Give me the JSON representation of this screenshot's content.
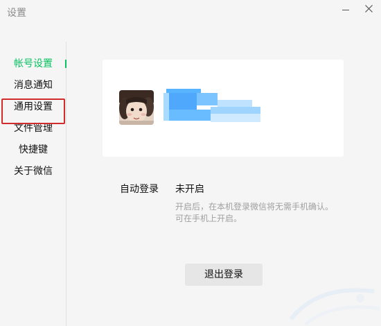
{
  "window": {
    "title": "设置",
    "minimize_icon": "minimize-icon",
    "close_icon": "close-icon"
  },
  "sidebar": {
    "items": [
      {
        "label": "帐号设置",
        "active": true
      },
      {
        "label": "消息通知",
        "active": false
      },
      {
        "label": "通用设置",
        "active": false,
        "highlighted": true
      },
      {
        "label": "文件管理",
        "active": false
      },
      {
        "label": "快捷键",
        "active": false
      },
      {
        "label": "关于微信",
        "active": false
      }
    ]
  },
  "account": {
    "avatar_icon": "avatar-photo",
    "name_obscured": true
  },
  "auto_login": {
    "label": "自动登录",
    "value": "未开启",
    "description_line1": "开启后，在本机登录微信将无需手机确认。",
    "description_line2": "可在手机上开启。"
  },
  "logout_button": {
    "label": "退出登录"
  },
  "colors": {
    "accent": "#07c160",
    "highlight_box": "#d12b2b",
    "background": "#f5f5f5",
    "card": "#ffffff",
    "button": "#e6e6e6"
  }
}
